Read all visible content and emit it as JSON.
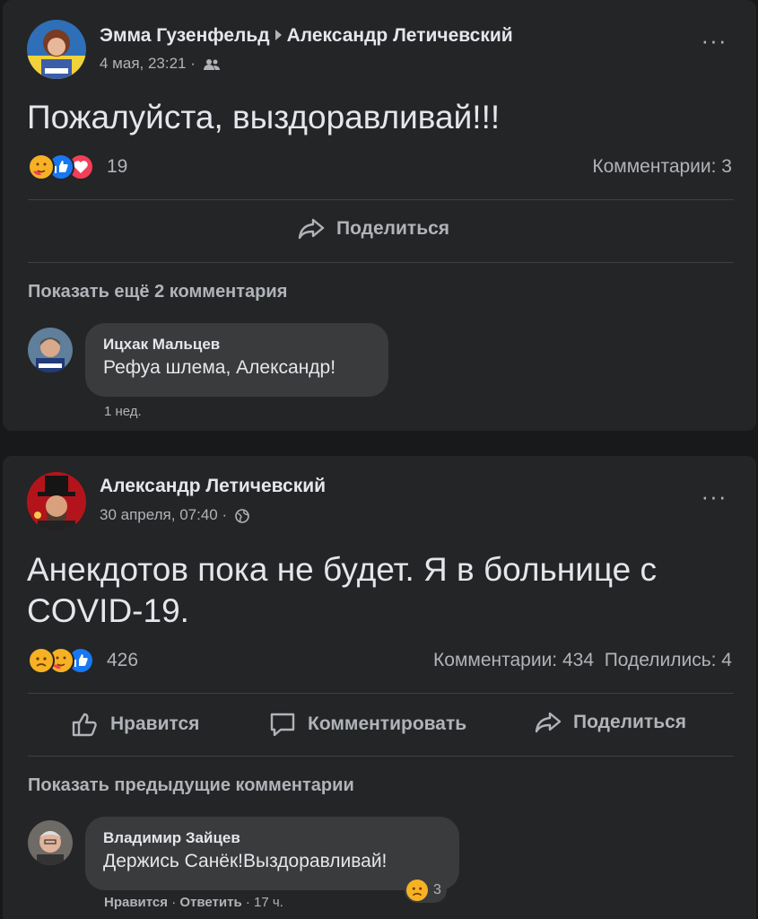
{
  "post1": {
    "author": "Эмма Гузенфельд",
    "recipient": "Александр Летичевский",
    "timestamp": "4 мая, 23:21",
    "privacy_icon": "friends-icon",
    "text": "Пожалуйста, выздоравливай!!!",
    "reaction_icons": [
      "care-emoji",
      "like-emoji",
      "love-emoji"
    ],
    "reaction_count": "19",
    "comments_count": "Комментарии: 3",
    "share_label": "Поделиться",
    "show_more": "Показать ещё 2 комментария",
    "comment": {
      "author": "Ицхак Мальцев",
      "text": "Рефуа шлема, Александр!",
      "time": "1 нед."
    }
  },
  "post2": {
    "author": "Александр Летичевский",
    "timestamp": "30 апреля, 07:40",
    "privacy_icon": "globe-icon",
    "text": "Анекдотов пока не будет. Я в больнице с COVID-19.",
    "reaction_icons": [
      "sad-emoji",
      "care-emoji",
      "like-emoji"
    ],
    "reaction_count": "426",
    "comments_count": "Комментарии: 434",
    "shares_count": "Поделились: 4",
    "like_label": "Нравится",
    "comment_label": "Комментировать",
    "share_label": "Поделиться",
    "show_previous": "Показать предыдущие комментарии",
    "comment": {
      "author": "Владимир Зайцев",
      "text": "Держись Санёк!Выздоравливай!",
      "like": "Нравится",
      "reply": "Ответить",
      "time": "17 ч.",
      "reaction_count": "3"
    }
  },
  "colors": {
    "background": "#18191a",
    "card": "#242526",
    "bubble": "#3a3b3c",
    "text_primary": "#e4e6eb",
    "text_secondary": "#b0b3b8",
    "like_blue": "#1877f2",
    "love_red": "#f33e58",
    "emoji_yellow": "#f7b125"
  }
}
